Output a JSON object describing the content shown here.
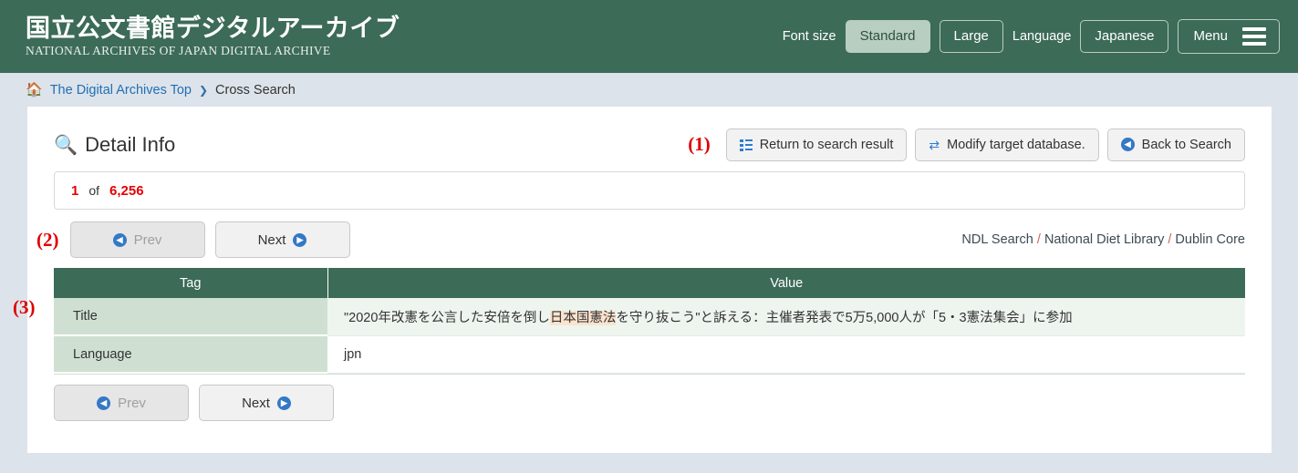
{
  "header": {
    "logo_jp": "国立公文書館デジタルアーカイブ",
    "logo_en": "NATIONAL ARCHIVES OF JAPAN  DIGITAL ARCHIVE",
    "font_size_label": "Font size",
    "font_size_standard": "Standard",
    "font_size_large": "Large",
    "language_label": "Language",
    "language_value": "Japanese",
    "menu_label": "Menu",
    "bg_color": "#3c6b58"
  },
  "breadcrumb": {
    "home_icon": "home-icon",
    "top_link": "The Digital Archives Top",
    "separator": "❯",
    "current": "Cross Search"
  },
  "main": {
    "title": "Detail Info",
    "search_icon": "magnifier-icon",
    "annotations": {
      "one": "(1)",
      "two": "(2)",
      "three": "(3)",
      "color": "#e00000"
    },
    "actions": [
      {
        "label": "Return to search result",
        "icon": "list-icon"
      },
      {
        "label": "Modify target database.",
        "icon": "exchange-arrows-icon"
      },
      {
        "label": "Back to Search",
        "icon": "circle-chevron-left-icon"
      }
    ],
    "counter": {
      "current": "1",
      "of": "of",
      "total": "6,256",
      "color": "#e60000"
    },
    "pager": {
      "prev_label": "Prev",
      "next_label": "Next",
      "prev_icon": "circle-chevron-left-icon",
      "next_icon": "circle-chevron-right-icon",
      "prev_disabled": true
    },
    "database_path": {
      "parts": [
        "NDL Search",
        "National Diet Library",
        "Dublin Core"
      ],
      "separator": "/"
    },
    "table": {
      "columns": [
        "Tag",
        "Value"
      ],
      "rows": [
        {
          "tag": "Title",
          "value_before": "\"2020年改憲を公言した安倍を倒し",
          "value_highlight": "日本国憲法",
          "value_after": "を守り抜こう\"と訴える：主催者発表で5万5,000人が「5・3憲法集会」に参加"
        },
        {
          "tag": "Language",
          "value_before": "jpn",
          "value_highlight": "",
          "value_after": ""
        }
      ]
    }
  }
}
